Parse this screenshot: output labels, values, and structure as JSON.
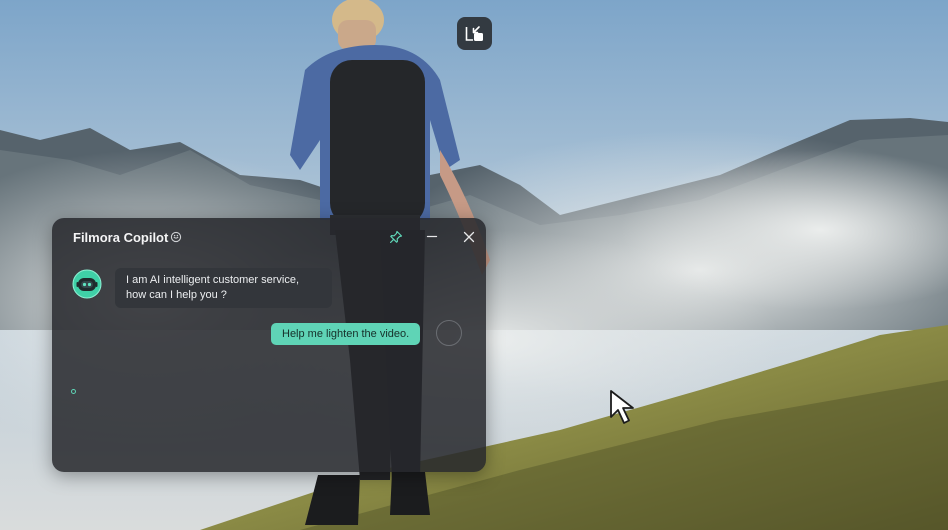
{
  "colors": {
    "accent": "#5fd4b6",
    "panel": "#26282c",
    "bubble": "#33363b"
  },
  "copilot": {
    "title": "Filmora Copilot",
    "info_icon": "info-icon",
    "buttons": {
      "pin": "pin-icon",
      "minimize": "minimize-icon",
      "close": "close-icon"
    },
    "messages": [
      {
        "role": "assistant",
        "avatar": "robot-avatar-icon",
        "text": "I am AI intelligent customer service, how can I help you ?"
      },
      {
        "role": "user",
        "avatar": "user-avatar",
        "text": "Help me lighten the video."
      }
    ]
  },
  "player": {
    "exit_fullscreen_icon": "exit-fullscreen-icon"
  },
  "pointer": "mouse-cursor-icon"
}
